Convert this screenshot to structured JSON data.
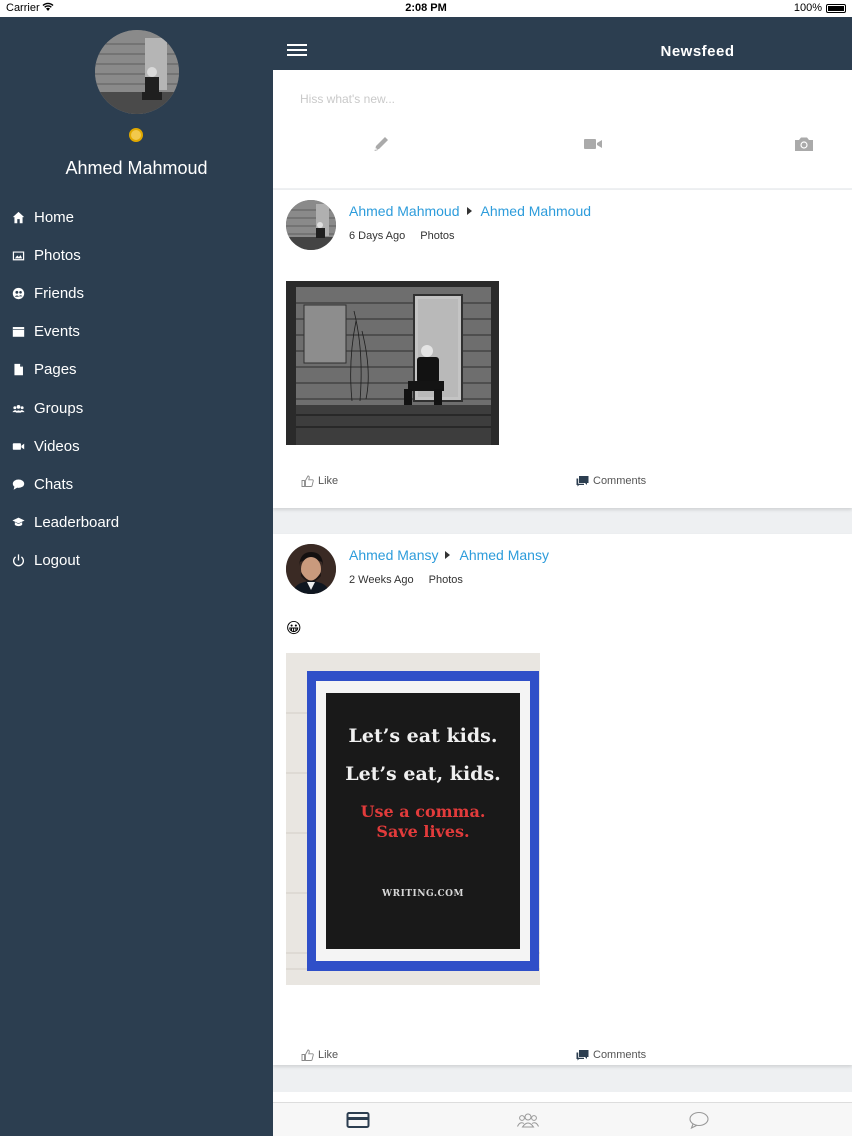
{
  "status_bar": {
    "carrier": "Carrier",
    "time": "2:08 PM",
    "battery": "100%"
  },
  "sidebar": {
    "user_name": "Ahmed Mahmoud",
    "items": [
      {
        "label": "Home",
        "icon": "home-icon"
      },
      {
        "label": "Photos",
        "icon": "photos-icon"
      },
      {
        "label": "Friends",
        "icon": "friends-icon"
      },
      {
        "label": "Events",
        "icon": "events-icon"
      },
      {
        "label": "Pages",
        "icon": "pages-icon"
      },
      {
        "label": "Groups",
        "icon": "groups-icon"
      },
      {
        "label": "Videos",
        "icon": "videos-icon"
      },
      {
        "label": "Chats",
        "icon": "chats-icon"
      },
      {
        "label": "Leaderboard",
        "icon": "leaderboard-icon"
      },
      {
        "label": "Logout",
        "icon": "logout-icon"
      }
    ]
  },
  "header": {
    "title": "Newsfeed"
  },
  "composer": {
    "placeholder": "Hiss what's new..."
  },
  "posts": [
    {
      "author": "Ahmed Mahmoud",
      "target": "Ahmed Mahmoud",
      "time": "6 Days Ago",
      "type": "Photos",
      "like_label": "Like",
      "comments_label": "Comments"
    },
    {
      "author": "Ahmed Mansy",
      "target": "Ahmed Mansy",
      "time": "2 Weeks Ago",
      "type": "Photos",
      "emoji": "😀",
      "poster": {
        "line1": "Let’s eat kids.",
        "line2": "Let’s eat, kids.",
        "line3": "Use a comma.",
        "line4": "Save lives.",
        "brand": "WRITING.COM"
      },
      "like_label": "Like",
      "comments_label": "Comments"
    }
  ],
  "colors": {
    "sidebar_bg": "#2c3e50",
    "link": "#2d9cdb",
    "poster_frame": "#2f4fc8",
    "poster_red": "#e23b3b"
  }
}
